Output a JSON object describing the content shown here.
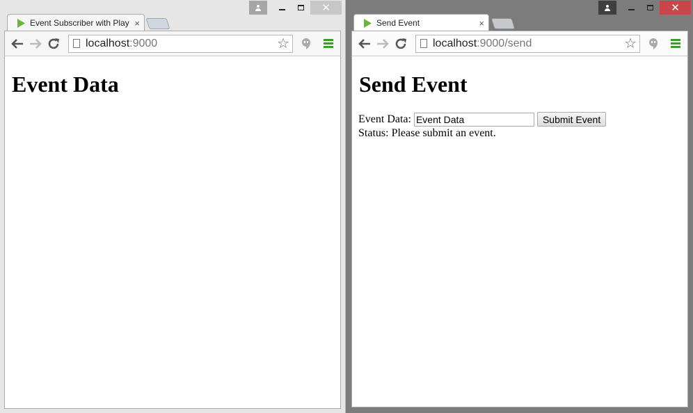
{
  "left_window": {
    "tab": {
      "title": "Event Subscriber with Play",
      "close": "×"
    },
    "omnibox": {
      "host": "localhost",
      "path": ":9000"
    },
    "page": {
      "heading": "Event Data"
    }
  },
  "right_window": {
    "tab": {
      "title": "Send Event",
      "close": "×"
    },
    "omnibox": {
      "host": "localhost",
      "path": ":9000/send"
    },
    "page": {
      "heading": "Send Event",
      "field_label": "Event Data:",
      "field_value": "Event Data",
      "submit_label": "Submit Event",
      "status_label": "Status:",
      "status_text": "Please submit an event."
    }
  },
  "caption": {
    "close_glyph": "✕"
  },
  "icons": {
    "favicon": "play-triangle-icon",
    "back": "back-arrow-icon",
    "forward": "forward-arrow-icon",
    "reload": "reload-icon",
    "page": "page-icon",
    "bookmark": "star-icon",
    "hangouts": "hangouts-icon",
    "menu": "menu-icon"
  },
  "colors": {
    "favicon_green": "#6db33f",
    "menu_green": "#3a9e26",
    "close_red": "#c7464a"
  }
}
